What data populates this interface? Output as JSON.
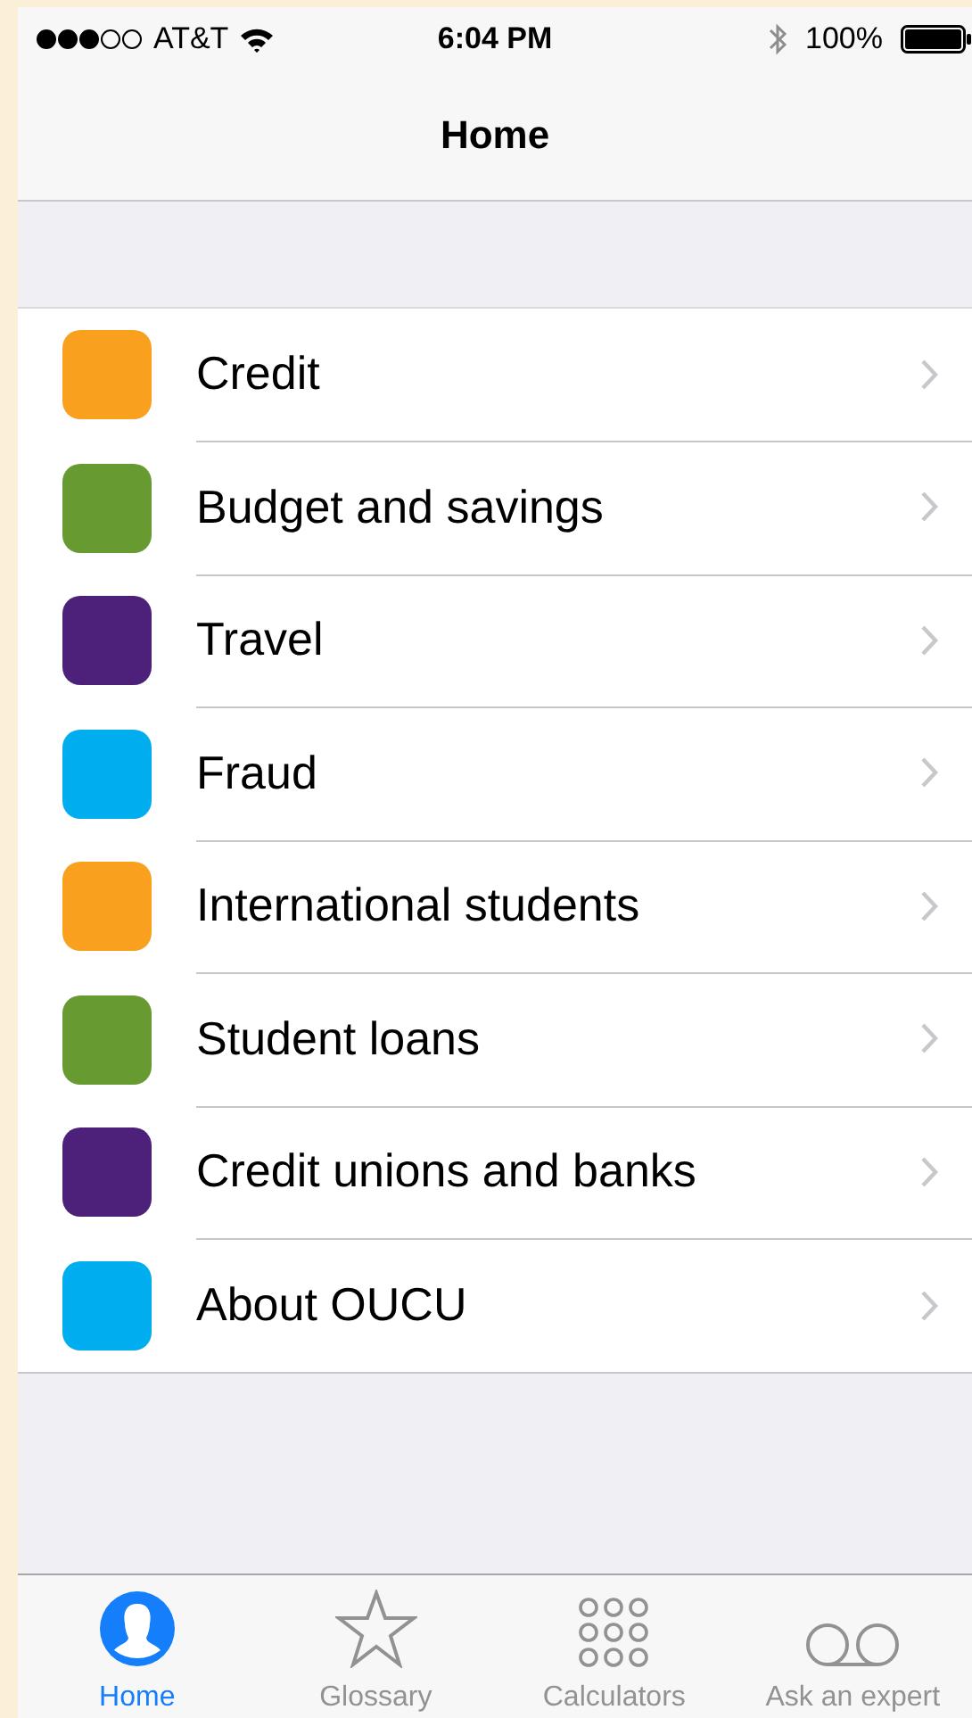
{
  "status_bar": {
    "carrier": "AT&T",
    "time": "6:04 PM",
    "battery": "100%"
  },
  "nav_bar": {
    "title": "Home"
  },
  "menu": [
    {
      "label": "Credit",
      "color": "#f9a11f"
    },
    {
      "label": "Budget and savings",
      "color": "#679b32"
    },
    {
      "label": "Travel",
      "color": "#4d2079"
    },
    {
      "label": "Fraud",
      "color": "#00aeef"
    },
    {
      "label": "International students",
      "color": "#f9a11f"
    },
    {
      "label": "Student loans",
      "color": "#679b32"
    },
    {
      "label": "Credit unions and banks",
      "color": "#4d2079"
    },
    {
      "label": "About OUCU",
      "color": "#00aeef"
    }
  ],
  "tab_bar": [
    {
      "label": "Home",
      "kind": "person",
      "selected": true
    },
    {
      "label": "Glossary",
      "kind": "star",
      "selected": false
    },
    {
      "label": "Calculators",
      "kind": "grid",
      "selected": false
    },
    {
      "label": "Ask an expert",
      "kind": "voicemail",
      "selected": false
    }
  ]
}
